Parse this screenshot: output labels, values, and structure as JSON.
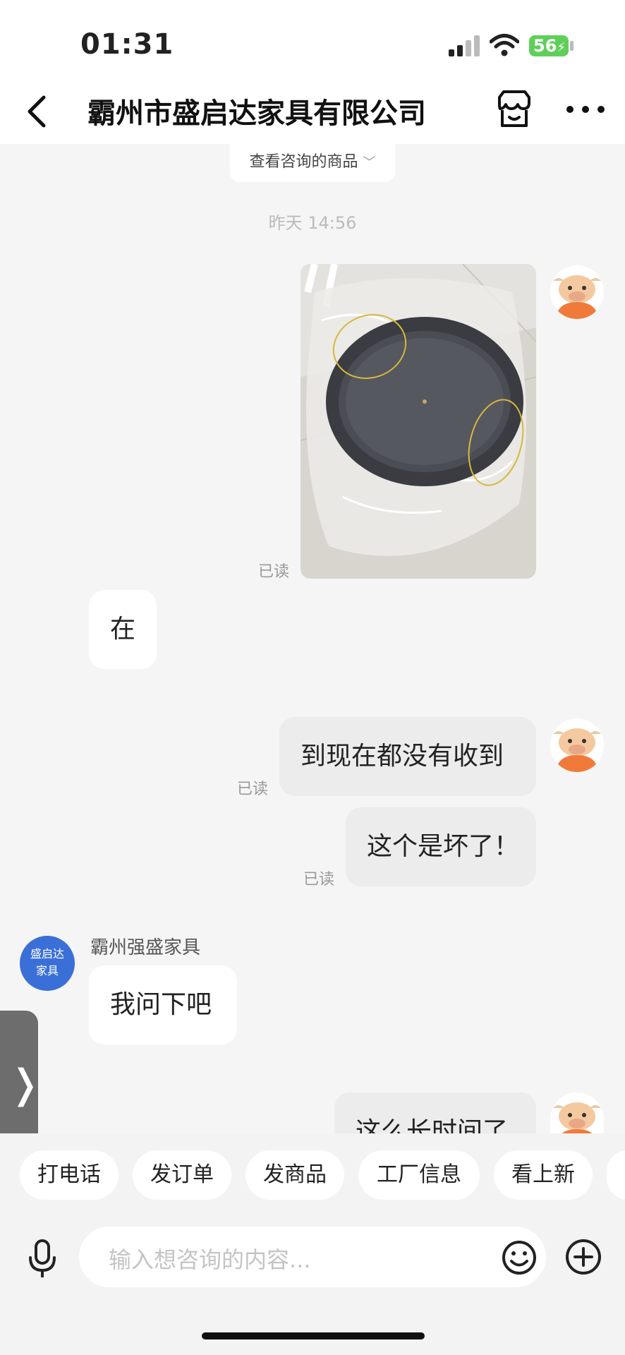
{
  "status": {
    "time": "01:31",
    "battery": "56"
  },
  "nav": {
    "title": "霸州市盛启达家具有限公司"
  },
  "goods_tab": {
    "label": "查看咨询的商品"
  },
  "chat": {
    "timestamp": "昨天 14:56",
    "read_label": "已读",
    "msg_in_1": "在",
    "msg_out_1": "到现在都没有收到",
    "msg_out_2": "这个是坏了！",
    "sender_name": "霸州强盛家具",
    "shop_avatar_text": "盛启达家具",
    "msg_in_2": "我问下吧",
    "msg_out_3": "这么长时间了"
  },
  "quick_actions": [
    "打电话",
    "发订单",
    "发商品",
    "工厂信息",
    "看上新"
  ],
  "input": {
    "placeholder": "输入想咨询的内容..."
  },
  "icons": {
    "back": "chevron-left-icon",
    "shop": "shop-icon",
    "more": "more-icon",
    "mic": "mic-icon",
    "emoji": "emoji-icon",
    "plus": "plus-icon"
  }
}
